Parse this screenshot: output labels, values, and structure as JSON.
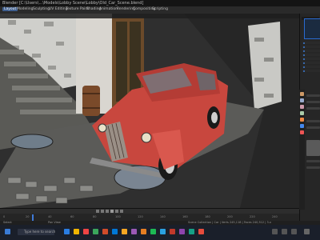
{
  "window": {
    "title": "Blender [C:\\Users\\...\\Models\\Lobby Scene\\Lobby\\Old_Car_Scene.blend]"
  },
  "menubar": {
    "items": [
      "Layout",
      "Modeling",
      "Sculpting",
      "UV Editing",
      "Texture Paint",
      "Shading",
      "Animation",
      "Rendering",
      "Compositing",
      "Scripting"
    ],
    "active_index": 0
  },
  "timeline": {
    "frames": [
      "0",
      "20",
      "40",
      "60",
      "80",
      "100",
      "120",
      "140",
      "160",
      "180",
      "200",
      "220",
      "240"
    ],
    "current_frame": 1
  },
  "status": {
    "left": "Select",
    "mid": "Pan View",
    "right": "Scene Collection | Car | Verts 245,118 | Faces 240,512 | 3.x"
  },
  "taskbar": {
    "search_placeholder": "Type here to search",
    "icon_colors": [
      "#2a7de1",
      "#f0b400",
      "#e44",
      "#3ba55c",
      "#d04b2a",
      "#0078d7",
      "#f5a623",
      "#9b59b6",
      "#e67e22",
      "#1db954",
      "#2aa1e1",
      "#c0392b",
      "#8e44ad",
      "#16a085",
      "#e74c3c"
    ]
  },
  "colors": {
    "car_body": "#c8473e",
    "accent_blue": "#3f7ad8"
  }
}
